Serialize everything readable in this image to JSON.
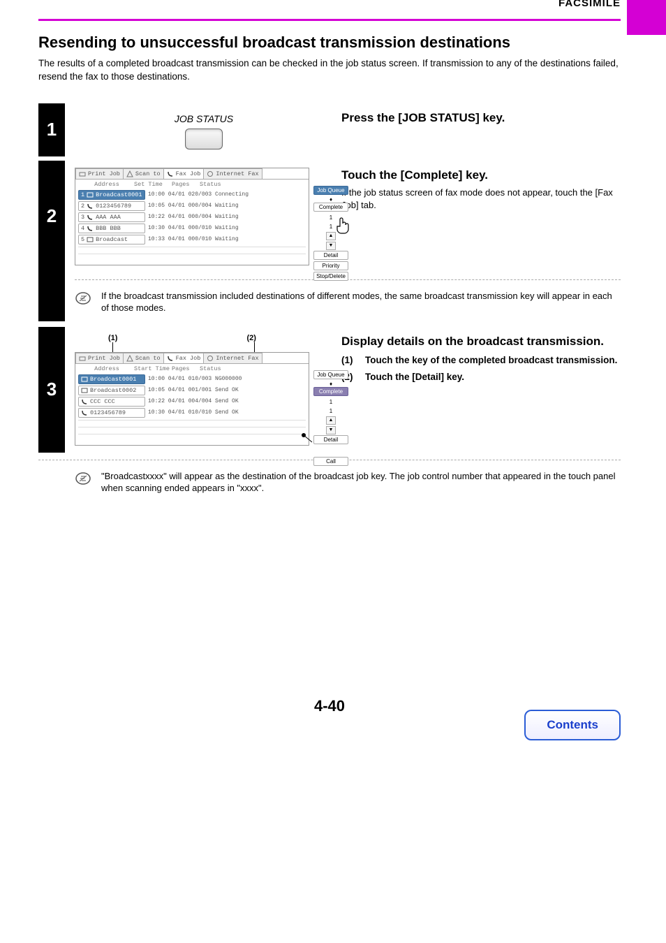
{
  "header": {
    "section": "FACSIMILE"
  },
  "title": "Resending to unsuccessful broadcast transmission destinations",
  "intro": "The results of a completed broadcast transmission can be checked in the job status screen. If transmission to any of the destinations failed, resend the fax to those destinations.",
  "steps": {
    "s1": {
      "num": "1",
      "graphic_label": "JOB STATUS",
      "title": "Press the [JOB STATUS] key."
    },
    "s2": {
      "num": "2",
      "title": "Touch the [Complete] key.",
      "desc": "If the job status screen of fax mode does not appear, touch the [Fax Job] tab.",
      "note": "If the broadcast transmission included destinations of different modes, the same broadcast transmission key will appear in each of those modes.",
      "panel": {
        "tabs": {
          "print": "Print Job",
          "scan": "Scan to",
          "fax": "Fax Job",
          "ifax": "Internet Fax"
        },
        "cols": {
          "addr": "Address",
          "time": "Set Time",
          "pages": "Pages",
          "status": "Status"
        },
        "rows": [
          {
            "n": "1",
            "addr": "Broadcast0001",
            "rest": "10:00 04/01 020/003 Connecting",
            "cls": "blue"
          },
          {
            "n": "2",
            "addr": "0123456789",
            "rest": "10:05 04/01 000/004 Waiting",
            "cls": ""
          },
          {
            "n": "3",
            "addr": "AAA AAA",
            "rest": "10:22 04/01 000/004 Waiting",
            "cls": ""
          },
          {
            "n": "4",
            "addr": "BBB BBB",
            "rest": "10:30 04/01 000/010 Waiting",
            "cls": ""
          },
          {
            "n": "5",
            "addr": "Broadcast",
            "rest": "10:33 04/01 000/010 Waiting",
            "cls": ""
          }
        ],
        "side": {
          "queue": "Job Queue",
          "complete": "Complete",
          "pg1": "1",
          "pg2": "1",
          "detail": "Detail",
          "priority": "Priority",
          "stop": "Stop/Delete"
        }
      }
    },
    "s3": {
      "num": "3",
      "callouts": {
        "c1": "(1)",
        "c2": "(2)"
      },
      "title": "Display details on the broadcast transmission.",
      "list": {
        "i1n": "(1)",
        "i1t": "Touch the key of the completed broadcast transmission.",
        "i2n": "(2)",
        "i2t": "Touch the [Detail] key."
      },
      "note": "\"Broadcastxxxx\" will appear as the destination of the broadcast job key. The job control number that appeared in the touch panel when scanning ended appears in \"xxxx\".",
      "panel": {
        "tabs": {
          "print": "Print Job",
          "scan": "Scan to",
          "fax": "Fax Job",
          "ifax": "Internet Fax"
        },
        "cols": {
          "addr": "Address",
          "time": "Start Time",
          "pages": "Pages",
          "status": "Status"
        },
        "rows": [
          {
            "addr": "Broadcast0001",
            "rest": "10:00 04/01 010/003 NG000000",
            "cls": "blue"
          },
          {
            "addr": "Broadcast0002",
            "rest": "10:05 04/01 001/001 Send OK",
            "cls": ""
          },
          {
            "addr": "CCC CCC",
            "rest": "10:22 04/01 004/004 Send OK",
            "cls": ""
          },
          {
            "addr": "0123456789",
            "rest": "10:30 04/01 010/010 Send OK",
            "cls": ""
          }
        ],
        "side": {
          "queue": "Job Queue",
          "complete": "Complete",
          "pg1": "1",
          "pg2": "1",
          "detail": "Detail",
          "call": "Call"
        }
      }
    }
  },
  "pagenum": "4-40",
  "contents": "Contents"
}
